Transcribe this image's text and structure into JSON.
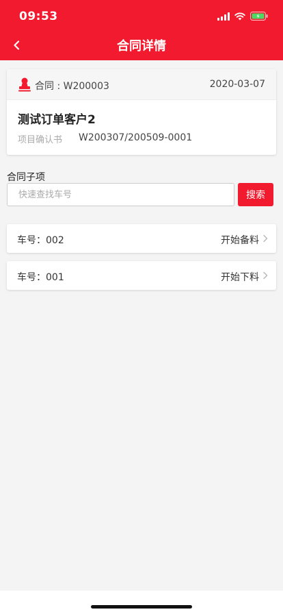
{
  "status_bar": {
    "time": "09:53"
  },
  "nav": {
    "title": "合同详情"
  },
  "contract": {
    "number_label": "合同 : W200003",
    "date": "2020-03-07",
    "customer": "测试订单客户2",
    "confirm_label": "项目确认书",
    "confirm_value": "W200307/200509-0001"
  },
  "sub_items": {
    "title": "合同子项",
    "search_placeholder": "快速查找车号",
    "search_button": "搜索",
    "items": [
      {
        "label": "车号：002",
        "action": "开始备料"
      },
      {
        "label": "车号：001",
        "action": "开始下料"
      }
    ]
  },
  "colors": {
    "brand": "#f11a2e",
    "background": "#f4f4f4"
  }
}
